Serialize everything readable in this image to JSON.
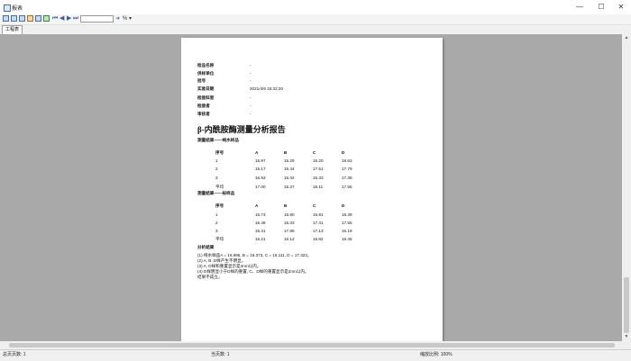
{
  "window": {
    "title": "报表",
    "min_label": "—",
    "max_label": "☐",
    "close_label": "✕"
  },
  "toolbar": {
    "page_input_value": "",
    "zoom_label": "%",
    "zoom_arrow": "▾",
    "go_arrow": "➜"
  },
  "tab": {
    "label": "工程表"
  },
  "report": {
    "meta": [
      {
        "label": "检品名称",
        "value": "-"
      },
      {
        "label": "供样单位",
        "value": "-"
      },
      {
        "label": "批号",
        "value": "-"
      },
      {
        "label": "实验日期",
        "value": "2021/4/6 15:32:20"
      },
      {
        "label": "检验科室",
        "value": "-"
      },
      {
        "label": "检验者",
        "value": "-"
      },
      {
        "label": "审核者",
        "value": "-"
      }
    ],
    "title": "β-内酰胺酶测量分析报告",
    "table1": {
      "title": "测量结果——纯水样品",
      "headers": [
        "序号",
        "A",
        "B",
        "C",
        "D"
      ],
      "rows": [
        [
          "1",
          "15.97",
          "15.29",
          "15.20",
          "18.63"
        ],
        [
          "2",
          "15.17",
          "15.44",
          "17.51",
          "17.79"
        ],
        [
          "3",
          "16.93",
          "15.42",
          "15.33",
          "17.38"
        ],
        [
          "平均",
          "17.00",
          "15.37",
          "16.11",
          "17.55"
        ]
      ]
    },
    "table2": {
      "title": "测量结果——标样品",
      "headers": [
        "序号",
        "A",
        "B",
        "C",
        "D"
      ],
      "rows": [
        [
          "1",
          "15.73",
          "15.90",
          "15.91",
          "18.39"
        ],
        [
          "2",
          "16.48",
          "15.33",
          "17.41",
          "17.55"
        ],
        [
          "3",
          "15.41",
          "17.88",
          "17.13",
          "15.19"
        ],
        [
          "平均",
          "16.21",
          "16.12",
          "16.82",
          "16.45"
        ]
      ]
    },
    "analysis": {
      "title": "分析结果",
      "lines": [
        "(1) 纯水样品A = 16.995, B = 15.373, C = 16.111, D = 17.322。",
        "(2) A, B, D样产生不明显。",
        "(3) A, D样和重置显示是2nm以内。",
        "(4) D样明显小于D样的重置, C、D样的重置显示是2nm以内。",
        "    结果不成立。"
      ]
    }
  },
  "status": {
    "total_pages": "总页页数: 1",
    "current_page": "当页数: 1",
    "zoom": "缩放比例: 100%"
  }
}
